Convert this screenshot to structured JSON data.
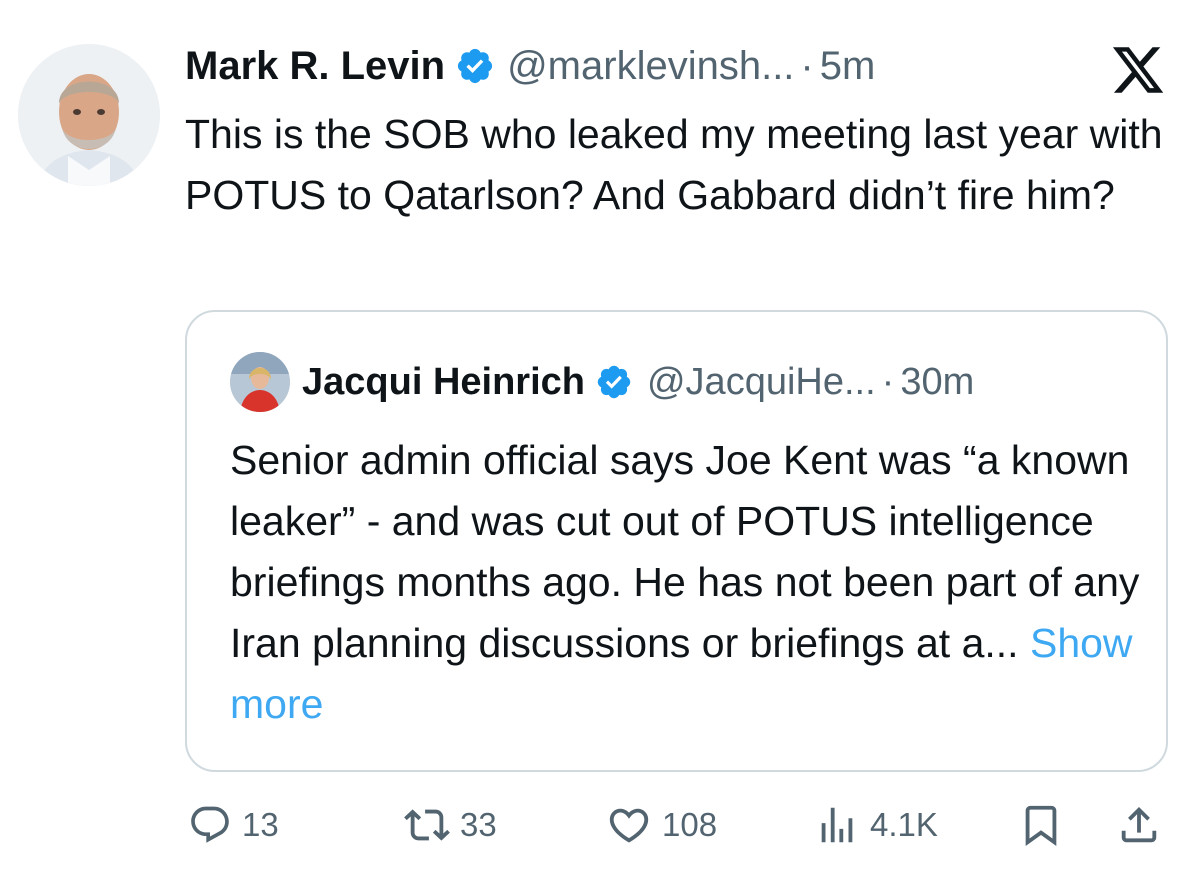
{
  "tweet": {
    "author_name": "Mark R. Levin",
    "handle": "@marklevinsh...",
    "separator": "·",
    "time": "5m",
    "text": "This is the SOB who leaked my meeting last year with POTUS to Qatarlson?  And Gabbard didn’t fire him?"
  },
  "quoted_tweet": {
    "author_name": "Jacqui Heinrich",
    "handle": "@JacquiHe...",
    "separator": "·",
    "time": "30m",
    "text": "Senior admin official says Joe Kent was “a known leaker” - and was cut out of POTUS intelligence briefings months ago. He has not been part of any Iran planning discussions or briefings at a...",
    "show_more": "Show more"
  },
  "actions": {
    "replies": "13",
    "reposts": "33",
    "likes": "108",
    "views": "4.1K"
  },
  "colors": {
    "text": "#0f1419",
    "secondary": "#536471",
    "link": "#1d9bf0",
    "verified": "#1d9bf0",
    "border": "#cfd9de"
  },
  "icons": {
    "verified": "verified-badge-icon",
    "platform": "x-logo-icon",
    "reply": "reply-icon",
    "repost": "repost-icon",
    "like": "heart-icon",
    "views": "views-chart-icon",
    "bookmark": "bookmark-icon",
    "share": "share-icon"
  }
}
